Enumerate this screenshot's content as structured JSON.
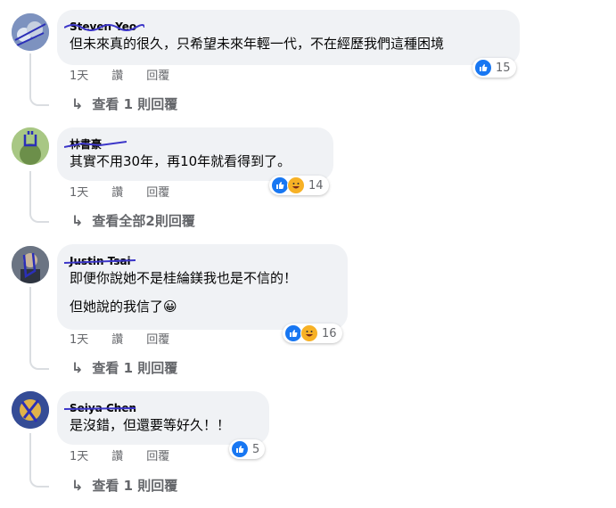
{
  "comments": [
    {
      "author": "Steven Yeo",
      "lines": [
        "但未來真的很久，只希望未來年輕一代，不在經歷我們這種困境"
      ],
      "time": "1天",
      "like_label": "讚",
      "reply_label": "回覆",
      "reaction_types": [
        "like"
      ],
      "reaction_count": "15",
      "replies_label": "查看 1 則回覆"
    },
    {
      "author": "林書豪",
      "lines": [
        "其實不用30年，再10年就看得到了。"
      ],
      "time": "1天",
      "like_label": "讚",
      "reply_label": "回覆",
      "reaction_types": [
        "like",
        "haha"
      ],
      "reaction_count": "14",
      "replies_label": "查看全部2則回覆"
    },
    {
      "author": "Justin Tsai",
      "lines": [
        "即便你說她不是桂綸鎂我也是不信的！",
        "但她說的我信了😀"
      ],
      "time": "1天",
      "like_label": "讚",
      "reply_label": "回覆",
      "reaction_types": [
        "like",
        "haha"
      ],
      "reaction_count": "16",
      "replies_label": "查看 1 則回覆"
    },
    {
      "author": "Seiya Chen",
      "lines": [
        "是沒錯，但還要等好久！！"
      ],
      "time": "1天",
      "like_label": "讚",
      "reply_label": "回覆",
      "reaction_types": [
        "like"
      ],
      "reaction_count": "5",
      "replies_label": "查看 1 則回覆"
    }
  ],
  "colors": {
    "bubble": "#f0f2f5",
    "like": "#1877f2",
    "haha": "#f7b125",
    "secondary_text": "#65676b",
    "scribble": "#3b35c8"
  }
}
